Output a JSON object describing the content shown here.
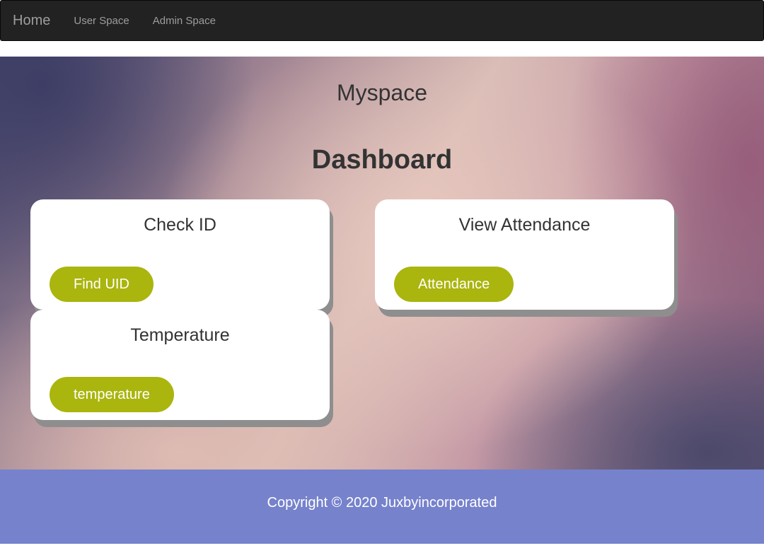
{
  "navbar": {
    "brand": "Home",
    "links": [
      "User Space",
      "Admin Space"
    ]
  },
  "hero": {
    "site_title": "Myspace",
    "dashboard_title": "Dashboard"
  },
  "cards": [
    {
      "title": "Check ID",
      "button": "Find UID"
    },
    {
      "title": "View Attendance",
      "button": "Attendance"
    },
    {
      "title": "Temperature",
      "button": "temperature"
    }
  ],
  "footer": {
    "copyright": "Copyright © 2020 Juxbyincorporated"
  },
  "colors": {
    "navbar_bg": "#222222",
    "button_bg": "#aab50e",
    "footer_bg": "#7682cc"
  }
}
